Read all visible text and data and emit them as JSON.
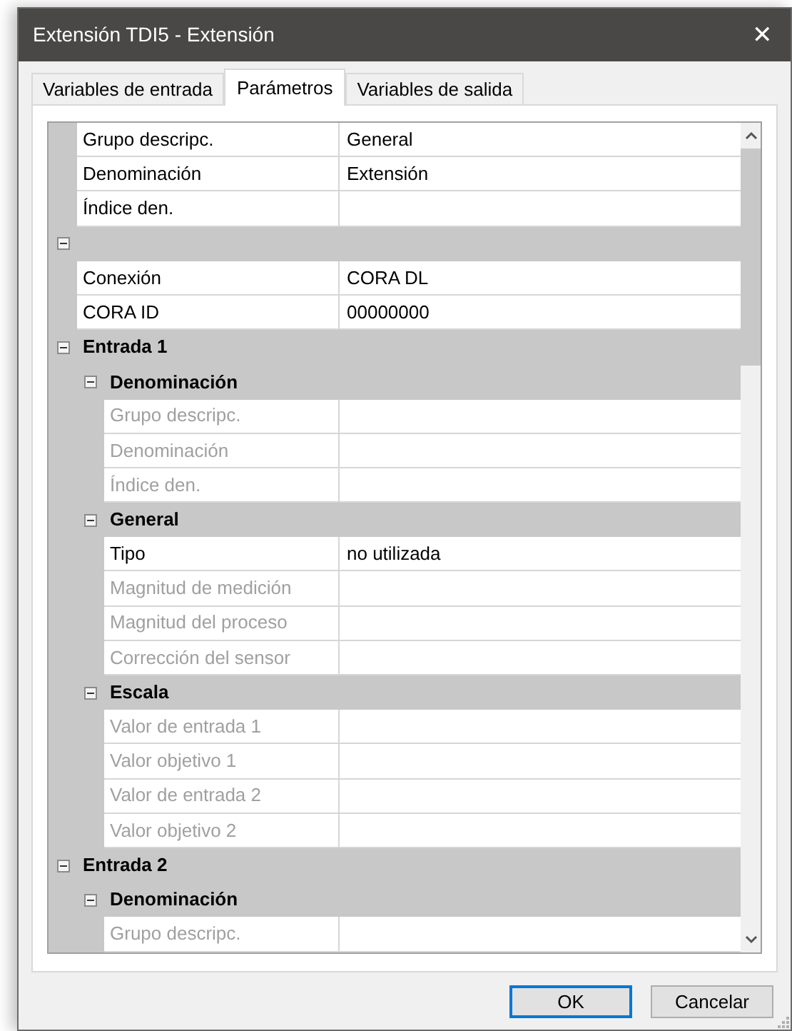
{
  "window": {
    "title": "Extensión TDI5 - Extensión",
    "close": "✕"
  },
  "tabs": [
    {
      "label": "Variables de entrada",
      "selected": false
    },
    {
      "label": "Parámetros",
      "selected": true
    },
    {
      "label": "Variables de salida",
      "selected": false
    }
  ],
  "grid": {
    "rows": [
      {
        "kind": "property",
        "name": "Grupo descripc.",
        "value": "General",
        "disabled": false
      },
      {
        "kind": "property",
        "name": "Denominación",
        "value": "Extensión",
        "disabled": false
      },
      {
        "kind": "property",
        "name": "Índice den.",
        "disabled": false
      },
      {
        "kind": "category",
        "expanded": true,
        "children": [
          {
            "kind": "property",
            "name": "Conexión",
            "value": "CORA DL",
            "disabled": false
          },
          {
            "kind": "property",
            "name": "CORA ID",
            "value": "00000000",
            "disabled": false
          }
        ]
      },
      {
        "kind": "category",
        "label": "Entrada 1",
        "expanded": true,
        "children": [
          {
            "kind": "category",
            "label": "Denominación",
            "expanded": true,
            "children": [
              {
                "kind": "property",
                "name": "Grupo descripc.",
                "disabled": true
              },
              {
                "kind": "property",
                "name": "Denominación",
                "disabled": true
              },
              {
                "kind": "property",
                "name": "Índice den.",
                "disabled": true
              }
            ]
          },
          {
            "kind": "category",
            "label": "General",
            "expanded": true,
            "children": [
              {
                "kind": "property",
                "name": "Tipo",
                "value": "no utilizada",
                "disabled": false
              },
              {
                "kind": "property",
                "name": "Magnitud de medición",
                "disabled": true
              },
              {
                "kind": "property",
                "name": "Magnitud del proceso",
                "disabled": true
              },
              {
                "kind": "property",
                "name": "Corrección del sensor",
                "disabled": true
              }
            ]
          },
          {
            "kind": "category",
            "label": "Escala",
            "expanded": true,
            "children": [
              {
                "kind": "property",
                "name": "Valor de entrada 1",
                "disabled": true
              },
              {
                "kind": "property",
                "name": "Valor objetivo 1",
                "disabled": true
              },
              {
                "kind": "property",
                "name": "Valor de entrada 2",
                "disabled": true
              },
              {
                "kind": "property",
                "name": "Valor objetivo 2",
                "disabled": true
              }
            ]
          }
        ]
      },
      {
        "kind": "category",
        "label": "Entrada 2",
        "expanded": true,
        "children": [
          {
            "kind": "category",
            "label": "Denominación",
            "expanded": true,
            "children": [
              {
                "kind": "property",
                "name": "Grupo descripc.",
                "disabled": true
              }
            ]
          }
        ]
      }
    ]
  },
  "buttons": [
    {
      "label": "OK",
      "default": true
    },
    {
      "label": "Cancelar",
      "default": false
    }
  ]
}
